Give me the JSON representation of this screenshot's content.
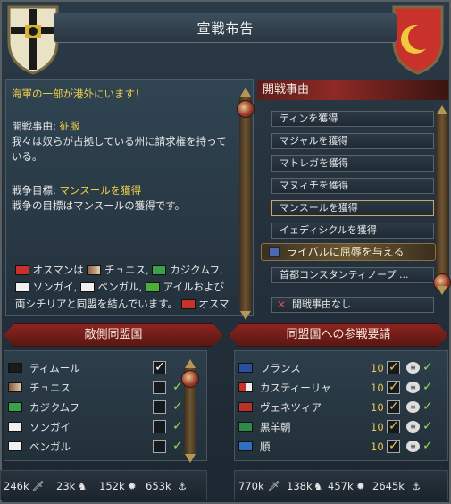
{
  "window": {
    "title": "宣戦布告"
  },
  "text_panel": {
    "warning": "海軍の一部が港外にいます！",
    "cb_label": "開戦事由:",
    "cb_value": "征服",
    "cb_desc_1": "我々は奴らが占拠している州に請求権を持って",
    "cb_desc_2": "いる。",
    "goal_label": "戦争目標:",
    "goal_value": "マンスールを獲得",
    "goal_desc": "戦争の目標はマンスールの獲得です。",
    "alliance_1": "オスマンは",
    "alliance_1b": "チュニス,",
    "alliance_1c": "カジクムフ,",
    "alliance_2a": "ソンガイ,",
    "alliance_2b": "ベンガル,",
    "alliance_2c": "アイルおよび",
    "alliance_3": "両シチリアと同盟を結んでいます。",
    "alliance_3b": "オスマ"
  },
  "casus_belli": {
    "header": "開戦事由",
    "items": [
      "ティンを獲得",
      "マジャルを獲得",
      "マトレガを獲得",
      "マヌィチを獲得",
      "マンスールを獲得",
      "イェディシクルを獲得"
    ],
    "selected_index": 4,
    "highlight": "ライバルに屈辱を与える",
    "extra": "首都コンスタンティノープ ...",
    "none": "開戦事由なし"
  },
  "enemy_allies": {
    "title": "敵側同盟国",
    "rows": [
      {
        "name": "ティムール",
        "checked": true
      },
      {
        "name": "チュニス",
        "checked": false
      },
      {
        "name": "カジクムフ",
        "checked": false
      },
      {
        "name": "ソンガイ",
        "checked": false
      },
      {
        "name": "ベンガル",
        "checked": false
      }
    ],
    "stats": {
      "infantry": "246k",
      "cavalry": "23k",
      "artillery": "152k",
      "navy": "653k"
    }
  },
  "call_allies": {
    "title": "同盟国への参戦要請",
    "rows": [
      {
        "name": "フランス",
        "value": "10"
      },
      {
        "name": "カスティーリャ",
        "value": "10"
      },
      {
        "name": "ヴェネツィア",
        "value": "10"
      },
      {
        "name": "黒羊朝",
        "value": "10"
      },
      {
        "name": "順",
        "value": "10"
      }
    ],
    "stats": {
      "infantry": "770k",
      "cavalry": "138k",
      "artillery": "457k",
      "navy": "2645k"
    }
  },
  "colors": {
    "accent_yellow": "#f2d04b",
    "ribbon_red": "#8c2420",
    "tick_green": "#9ad45a"
  }
}
